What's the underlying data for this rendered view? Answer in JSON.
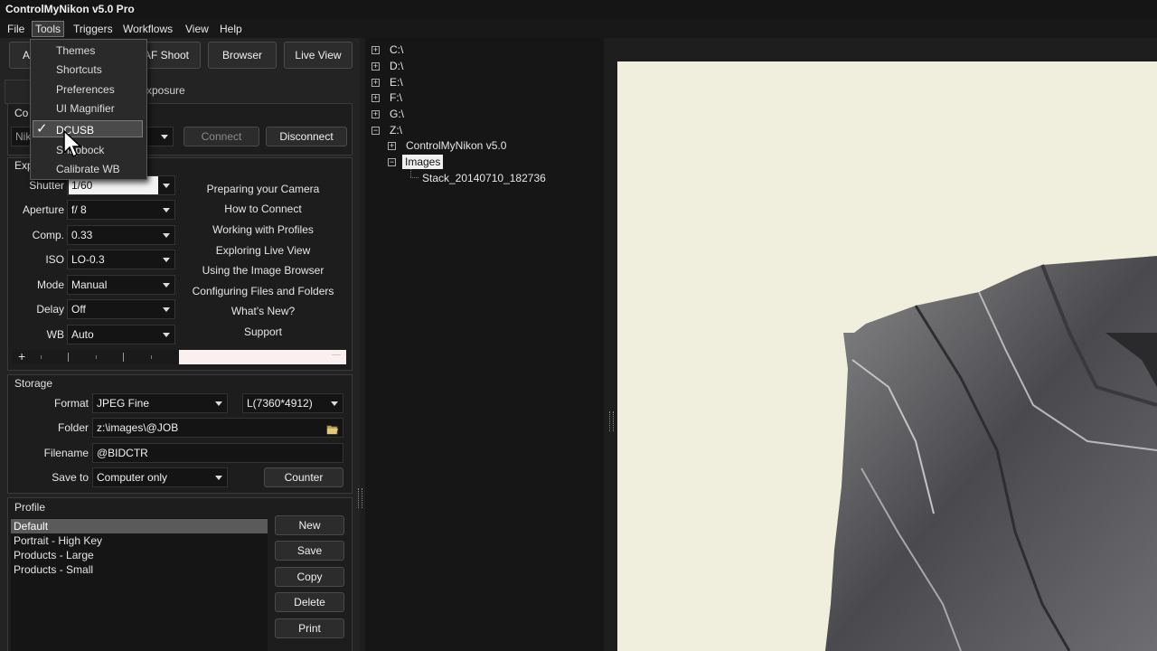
{
  "window": {
    "title": "ControlMyNikon v5.0 Pro"
  },
  "menubar": [
    "File",
    "Tools",
    "Triggers",
    "Workflows",
    "View",
    "Help"
  ],
  "tools_menu": {
    "items": [
      "Themes",
      "Shortcuts",
      "Preferences",
      "UI Magnifier",
      "DCUSB",
      "Snapbock",
      "Calibrate WB"
    ],
    "checked": "DCUSB"
  },
  "toolbar": {
    "a_label": "A",
    "af_shoot": "AF Shoot",
    "browser": "Browser",
    "live_view": "Live View"
  },
  "tabs": {
    "exposure": "Exposure"
  },
  "connection": {
    "section_title_partial": "Co",
    "camera_partial": "Nik",
    "connect": "Connect",
    "disconnect": "Disconnect"
  },
  "exposure": {
    "section_title_partial": "Exp",
    "settings": [
      {
        "label": "Shutter",
        "value": "1/60"
      },
      {
        "label": "Aperture",
        "value": "f/ 8"
      },
      {
        "label": "Comp.",
        "value": "0.33"
      },
      {
        "label": "ISO",
        "value": "LO-0.3"
      },
      {
        "label": "Mode",
        "value": "Manual"
      },
      {
        "label": "Delay",
        "value": "Off"
      },
      {
        "label": "WB",
        "value": "Auto"
      }
    ],
    "help_links": [
      "Preparing your Camera",
      "How to Connect",
      "Working with Profiles",
      "Exploring Live View",
      "Using the Image Browser",
      "Configuring Files and Folders",
      "What's New?",
      "Support"
    ],
    "plus": "+",
    "minus": "—"
  },
  "storage": {
    "title": "Storage",
    "format_label": "Format",
    "format_value": "JPEG Fine",
    "size_value": "L(7360*4912)",
    "folder_label": "Folder",
    "folder_value": "z:\\images\\@JOB",
    "filename_label": "Filename",
    "filename_value": "@BIDCTR",
    "saveto_label": "Save to",
    "saveto_value": "Computer only",
    "counter": "Counter"
  },
  "profile": {
    "title": "Profile",
    "items": [
      "Default",
      "Portrait - High Key",
      "Products - Large",
      "Products - Small"
    ],
    "selected": "Default",
    "buttons": [
      "New",
      "Save",
      "Copy",
      "Delete",
      "Print"
    ]
  },
  "tree": {
    "drives": [
      "C:\\",
      "D:\\",
      "E:\\",
      "F:\\",
      "G:\\",
      "Z:\\"
    ],
    "z_children": [
      "ControlMyNikon v5.0",
      "Images"
    ],
    "images_children": [
      "Stack_20140710_182736"
    ]
  },
  "colors": {
    "accent_selected": "#5a5a5a",
    "image_bg": "#f0eedd"
  }
}
